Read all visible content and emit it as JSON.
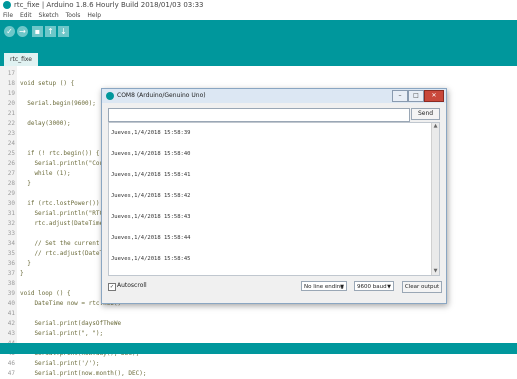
{
  "window": {
    "title": "rtc_fixe | Arduino 1.8.6 Hourly Build 2018/01/03 03:33",
    "icon": "arduino-icon"
  },
  "menu": [
    "File",
    "Edit",
    "Sketch",
    "Tools",
    "Help"
  ],
  "toolbar": {
    "buttons": [
      {
        "name": "verify-button",
        "icon": "check-icon",
        "glyph": "✓"
      },
      {
        "name": "upload-button",
        "icon": "arrow-right-icon",
        "glyph": "→"
      },
      {
        "name": "new-button",
        "icon": "new-file-icon",
        "glyph": "▪"
      },
      {
        "name": "open-button",
        "icon": "open-icon",
        "glyph": "↑"
      },
      {
        "name": "save-button",
        "icon": "save-icon",
        "glyph": "↓"
      }
    ],
    "color": "#00979c"
  },
  "tab": {
    "label": "rtc_fixe"
  },
  "code_lines": [
    {
      "n": "17",
      "text": ""
    },
    {
      "n": "18",
      "text": "void setup () {"
    },
    {
      "n": "19",
      "text": ""
    },
    {
      "n": "20",
      "text": "  Serial.begin(9600);"
    },
    {
      "n": "21",
      "text": ""
    },
    {
      "n": "22",
      "text": "  delay(3000);"
    },
    {
      "n": "23",
      "text": ""
    },
    {
      "n": "24",
      "text": ""
    },
    {
      "n": "25",
      "text": "  if (! rtc.begin()) {"
    },
    {
      "n": "26",
      "text": "    Serial.println(\"Couldn'"
    },
    {
      "n": "27",
      "text": "    while (1);"
    },
    {
      "n": "28",
      "text": "  }"
    },
    {
      "n": "29",
      "text": ""
    },
    {
      "n": "30",
      "text": "  if (rtc.lostPower()) {"
    },
    {
      "n": "31",
      "text": "    Serial.println(\"RTC lost"
    },
    {
      "n": "32",
      "text": "    rtc.adjust(DateTime(F(_"
    },
    {
      "n": "33",
      "text": ""
    },
    {
      "n": "34",
      "text": "    // Set the current date"
    },
    {
      "n": "35",
      "text": "    // rtc.adjust(DateTime("
    },
    {
      "n": "36",
      "text": "  }"
    },
    {
      "n": "37",
      "text": "}"
    },
    {
      "n": "38",
      "text": ""
    },
    {
      "n": "39",
      "text": "void loop () {"
    },
    {
      "n": "40",
      "text": "    DateTime now = rtc.now()"
    },
    {
      "n": "41",
      "text": ""
    },
    {
      "n": "42",
      "text": "    Serial.print(daysOfTheWe"
    },
    {
      "n": "43",
      "text": "    Serial.print(\", \");"
    },
    {
      "n": "44",
      "text": ""
    },
    {
      "n": "45",
      "text": "    Serial.print(now.day(), DEC);"
    },
    {
      "n": "46",
      "text": "    Serial.print('/');"
    },
    {
      "n": "47",
      "text": "    Serial.print(now.month(), DEC);"
    }
  ],
  "serial": {
    "title": "COM8 (Arduino/Genuino Uno)",
    "input_value": "",
    "send_label": "Send",
    "output": [
      "Jueves,1/4/2018 15:58:39",
      "Jueves,1/4/2018 15:58:40",
      "Jueves,1/4/2018 15:58:41",
      "Jueves,1/4/2018 15:58:42",
      "Jueves,1/4/2018 15:58:43",
      "Jueves,1/4/2018 15:58:44",
      "Jueves,1/4/2018 15:58:45"
    ],
    "autoscroll_label": "Autoscroll",
    "autoscroll_checked": true,
    "line_ending": "No line ending",
    "baud": "9600 baud",
    "clear_label": "Clear output",
    "minimize": "–",
    "maximize": "□",
    "close": "✕"
  }
}
